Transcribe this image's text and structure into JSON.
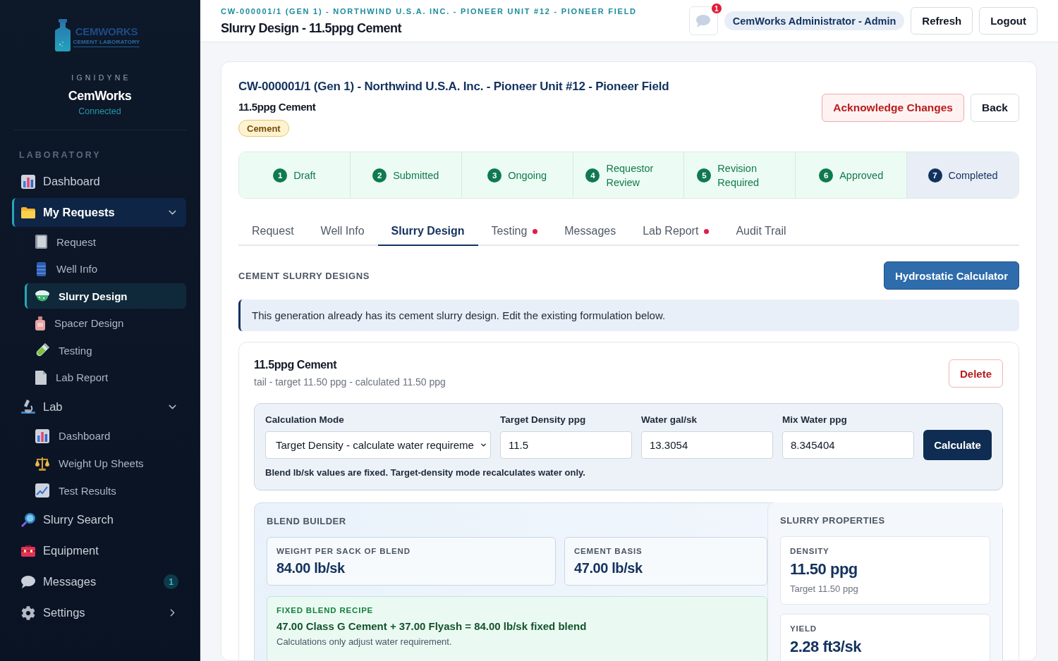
{
  "sidebar": {
    "logo": {
      "wordmark": "CEMWORKS",
      "tagline": "CEMENT LABORATORY"
    },
    "org": "IGNIDYNE",
    "app_name": "CemWorks",
    "status": "Connected",
    "section_label": "LABORATORY",
    "items": [
      {
        "label": "Dashboard",
        "selected": false
      },
      {
        "label": "My Requests",
        "selected": true,
        "expanded": true,
        "children": [
          {
            "label": "Request",
            "selected": false
          },
          {
            "label": "Well Info",
            "selected": false
          },
          {
            "label": "Slurry Design",
            "selected": true
          },
          {
            "label": "Spacer Design",
            "selected": false
          },
          {
            "label": "Testing",
            "selected": false
          },
          {
            "label": "Lab Report",
            "selected": false
          }
        ]
      },
      {
        "label": "Lab",
        "selected": false,
        "expanded": true,
        "children": [
          {
            "label": "Dashboard",
            "selected": false
          },
          {
            "label": "Weight Up Sheets",
            "selected": false
          },
          {
            "label": "Test Results",
            "selected": false
          }
        ]
      },
      {
        "label": "Slurry Search",
        "selected": false
      },
      {
        "label": "Equipment",
        "selected": false
      },
      {
        "label": "Messages",
        "selected": false,
        "badge": "1"
      },
      {
        "label": "Settings",
        "selected": false,
        "expanded": false
      }
    ]
  },
  "header": {
    "breadcrumb": "CW-000001/1 (GEN 1) - NORTHWIND U.S.A. INC. - PIONEER UNIT #12 - PIONEER FIELD",
    "title": "Slurry Design - 11.5ppg Cement",
    "notifications": "1",
    "user": "CemWorks Administrator - Admin",
    "buttons": [
      "Refresh",
      "Logout"
    ]
  },
  "request": {
    "title": "CW-000001/1 (Gen 1) - Northwind U.S.A. Inc. - Pioneer Unit #12 - Pioneer Field",
    "subtitle": "11.5ppg Cement",
    "tag": "Cement",
    "actions": [
      {
        "label": "Acknowledge Changes",
        "kind": "danger"
      },
      {
        "label": "Back",
        "kind": "plain"
      }
    ],
    "steps": [
      {
        "number": "1",
        "label": "Draft",
        "current": false
      },
      {
        "number": "2",
        "label": "Submitted",
        "current": false
      },
      {
        "number": "3",
        "label": "Ongoing",
        "current": false
      },
      {
        "number": "4",
        "label": "Requestor Review",
        "current": false
      },
      {
        "number": "5",
        "label": "Revision Required",
        "current": false
      },
      {
        "number": "6",
        "label": "Approved",
        "current": false
      },
      {
        "number": "7",
        "label": "Completed",
        "current": true
      }
    ]
  },
  "tabs": [
    {
      "label": "Request",
      "selected": false,
      "alert": false
    },
    {
      "label": "Well Info",
      "selected": false,
      "alert": false
    },
    {
      "label": "Slurry Design",
      "selected": true,
      "alert": false
    },
    {
      "label": "Testing",
      "selected": false,
      "alert": true
    },
    {
      "label": "Messages",
      "selected": false,
      "alert": false
    },
    {
      "label": "Lab Report",
      "selected": false,
      "alert": true
    },
    {
      "label": "Audit Trail",
      "selected": false,
      "alert": false
    }
  ],
  "section": {
    "title": "CEMENT SLURRY DESIGNS",
    "button": "Hydrostatic Calculator"
  },
  "notice": "This generation already has its cement slurry design. Edit the existing formulation below.",
  "design": {
    "title": "11.5ppg Cement",
    "meta": "tail - target 11.50 ppg - calculated 11.50 ppg",
    "delete_button": "Delete",
    "calculator": {
      "fields": [
        {
          "label": "Calculation Mode",
          "kind": "select",
          "value": "Target Density - calculate water requireme"
        },
        {
          "label": "Target Density ppg",
          "kind": "input",
          "value": "11.5"
        },
        {
          "label": "Water gal/sk",
          "kind": "input",
          "value": "13.3054"
        },
        {
          "label": "Mix Water ppg",
          "kind": "input",
          "value": "8.345404"
        }
      ],
      "button": "Calculate",
      "note": "Blend lb/sk values are fixed. Target-density mode recalculates water only."
    },
    "blend_builder": {
      "title": "BLEND BUILDER",
      "stats": [
        {
          "label": "WEIGHT PER SACK OF BLEND",
          "value": "84.00 lb/sk"
        },
        {
          "label": "CEMENT BASIS",
          "value": "47.00 lb/sk"
        }
      ],
      "recipe": {
        "label": "FIXED BLEND RECIPE",
        "formula": "47.00 Class G Cement + 37.00 Flyash = 84.00 lb/sk fixed blend",
        "note": "Calculations only adjust water requirement."
      }
    },
    "slurry_properties": {
      "title": "SLURRY PROPERTIES",
      "items": [
        {
          "label": "DENSITY",
          "value": "11.50 ppg",
          "note": "Target 11.50 ppg"
        },
        {
          "label": "YIELD",
          "value": "2.28 ft3/sk"
        }
      ]
    }
  }
}
